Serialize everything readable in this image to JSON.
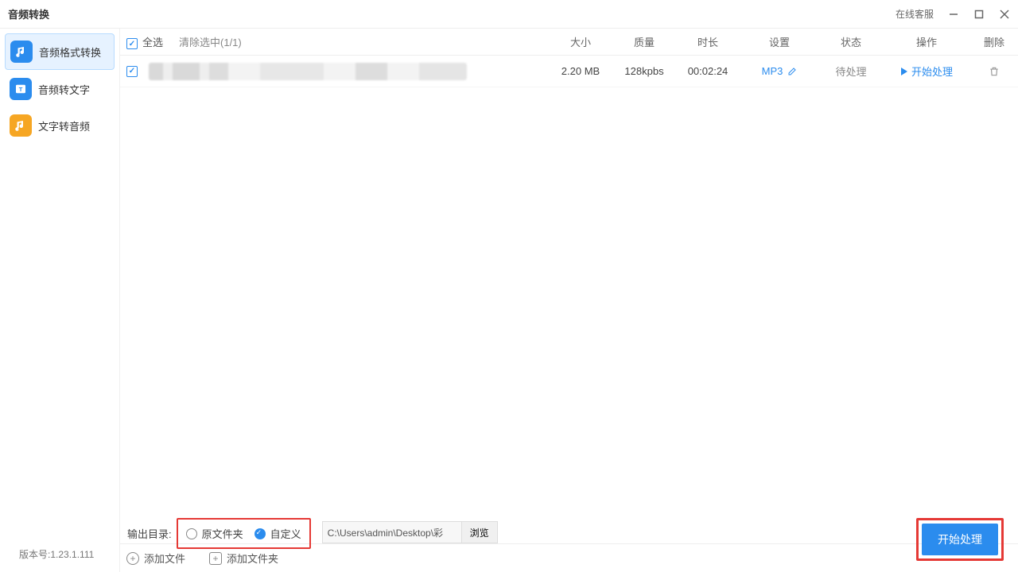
{
  "titlebar": {
    "title": "音频转换",
    "customer_service": "在线客服"
  },
  "sidebar": {
    "items": [
      {
        "label": "音频格式转换"
      },
      {
        "label": "音频转文字"
      },
      {
        "label": "文字转音频"
      }
    ]
  },
  "toolbar": {
    "select_all": "全选",
    "clear": "清除选中(1/1)",
    "cols": {
      "size": "大小",
      "quality": "质量",
      "duration": "时长",
      "setting": "设置",
      "status": "状态",
      "action": "操作",
      "delete": "删除"
    }
  },
  "rows": [
    {
      "size": "2.20 MB",
      "quality": "128kpbs",
      "duration": "00:02:24",
      "format": "MP3",
      "status": "待处理",
      "action": "开始处理"
    }
  ],
  "addbar": {
    "add_file": "添加文件",
    "add_folder": "添加文件夹"
  },
  "footer": {
    "output_label": "输出目录:",
    "radio_original": "原文件夹",
    "radio_custom": "自定义",
    "path": "C:\\Users\\admin\\Desktop\\彩",
    "browse": "浏览",
    "start": "开始处理"
  },
  "version": "版本号:1.23.1.111"
}
